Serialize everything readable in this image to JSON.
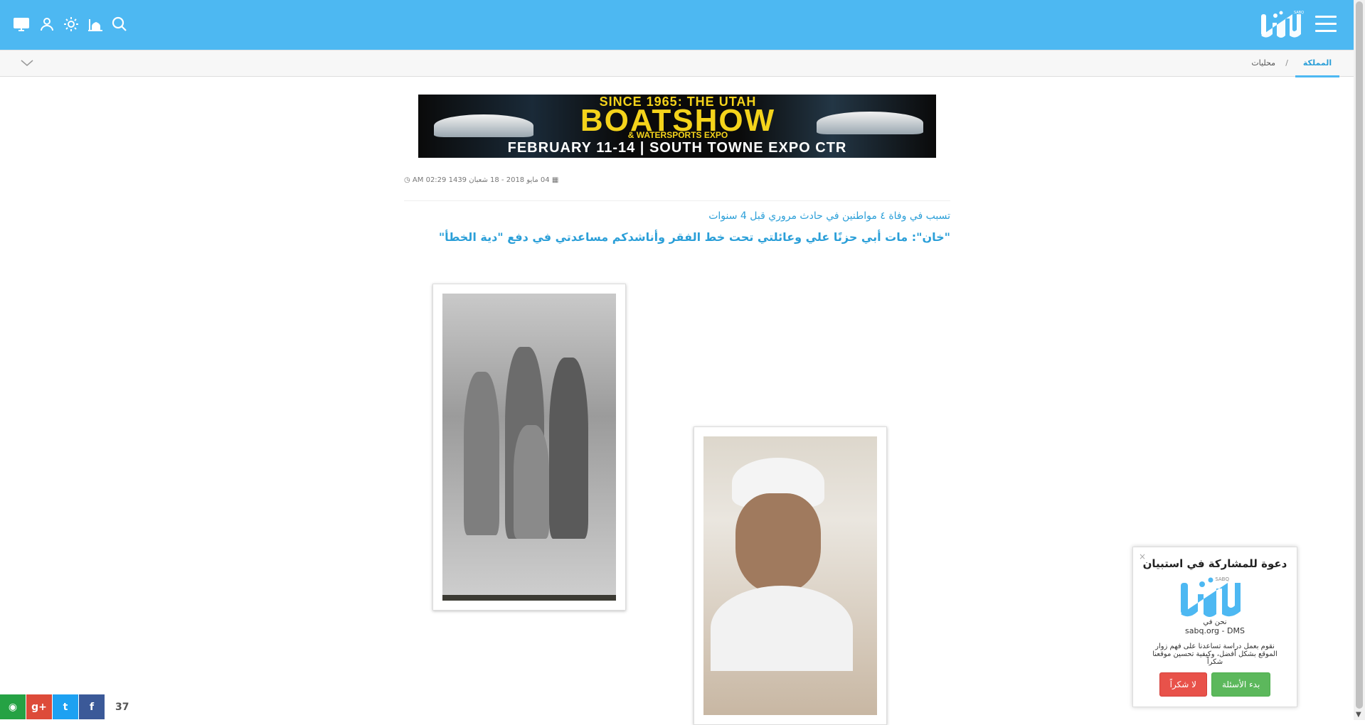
{
  "header": {
    "menu_icon": "hamburger-icon",
    "logo_text": "سبق",
    "logo_sub": "SABQ",
    "icons": [
      "search-icon",
      "mosque-icon",
      "sun-icon",
      "user-icon",
      "desktop-icon"
    ]
  },
  "breadcrumb": {
    "home": "المملكة",
    "separator": "/",
    "section": "محليات"
  },
  "banner": {
    "line1": "SINCE 1965: THE UTAH",
    "line2": "BOATSHOW",
    "line3": "& WATERSPORTS EXPO",
    "line4": "FEBRUARY 11-14  |  SOUTH TOWNE EXPO CTR"
  },
  "article": {
    "meta": "04 مايو 2018 - 18 شعبان 1439 02:29 AM",
    "subtitle": "تسبب في وفاة ٤ مواطنين في حادث مروري قبل 4 سنوات",
    "headline": "\"خان\": مات أبي حزنًا علي وعائلتي تحت خط الفقر وأناشدكم مساعدتي في دفع \"دية الخطأ\""
  },
  "share": {
    "count": "37",
    "buttons": [
      "facebook-icon",
      "twitter-icon",
      "google-plus-icon",
      "whatsapp-icon"
    ]
  },
  "survey": {
    "close": "×",
    "title": "دعوة للمشاركة في استبيان",
    "we_are": "نحن في",
    "site": "sabq.org - DMS",
    "description": "نقوم بعمل دراسة تساعدنا على فهم زوار الموقع بشكل أفضل، وكيفية تحسين موقعنا شكراً",
    "start_label": "بدء الأسئلة",
    "no_label": "لا شكراً"
  },
  "colors": {
    "brand": "#4db8f2",
    "link": "#2b9fd8",
    "facebook": "#3b5998",
    "twitter": "#1da1f2",
    "google": "#dd4b39",
    "whatsapp": "#25a244"
  }
}
